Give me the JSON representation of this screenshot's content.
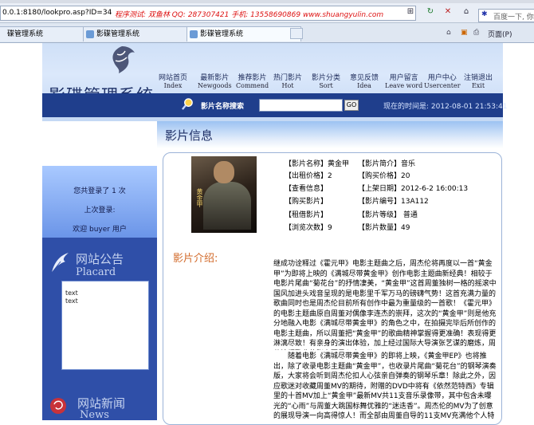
{
  "browser": {
    "url": "0.0.1:8180/lookpro.asp?ID=34",
    "ticker": "程序测试: 双鱼林  QQ: 287307421  手机: 13558690869  www.shuangyulin.com",
    "search_placeholder": "百度一下, 你",
    "tabs": [
      "碟管理系统",
      "影碟管理系统",
      "影碟管理系统"
    ],
    "page_menu": "页面(P)"
  },
  "header": {
    "site_title": "影碟管理系统",
    "nav": [
      {
        "cn": "网站首页",
        "en": "Index"
      },
      {
        "cn": "最新影片",
        "en": "Newgoods"
      },
      {
        "cn": "推荐影片",
        "en": "Commend"
      },
      {
        "cn": "热门影片",
        "en": "Hot"
      },
      {
        "cn": "影片分类",
        "en": "Sort"
      },
      {
        "cn": "意见反馈",
        "en": "Idea"
      },
      {
        "cn": "用户留言",
        "en": "Leave word"
      },
      {
        "cn": "用户中心",
        "en": "Usercenter"
      },
      {
        "cn": "注销退出",
        "en": "Exit"
      }
    ],
    "search_label": "影片名称搜索",
    "go_label": "GO",
    "time_label": "现在的时间是: 2012-08-01  21:53:41"
  },
  "left": {
    "user_lines": [
      "您共登录了 1 次",
      "上次登录:",
      "欢迎 buyer 用户"
    ],
    "placard_title": "网站公告",
    "placard_en": "Placard",
    "placard_text": [
      "text",
      "text"
    ],
    "news_title": "网站新闻",
    "news_en": "News"
  },
  "main": {
    "title": "影片信息",
    "poster_caption": "黄金甲",
    "info": [
      [
        "【影片名称】黄金甲",
        "【影片简介】音乐"
      ],
      [
        "【出租价格】2",
        "【购买价格】20"
      ],
      [
        "【查看信息】",
        "【上架日期】2012-6-2 16:00:13"
      ],
      [
        "【购买影片】",
        "【影片编号】13A112"
      ],
      [
        "【租借影片】",
        "【影片等级】 普通"
      ],
      [
        "【浏览次数】9",
        "【影片数量】49"
      ]
    ],
    "intro_title": "影片介绍:",
    "para1": "继成功诠释过《霍元甲》电影主题曲之后，周杰伦将再度以一首“黄金甲”为即将上映的《满城尽带黄金甲》创作电影主题曲新经典！相较于电影片尾曲“菊花台”的抒情凄美，“黄金甲”这首周董独树一格的摇滚中国风加进头戏音呈现的是电影里千军万马的磅礴气势！这首充满力量的歌曲同时也是周杰伦目前所有创作中最为重量级的一首歌！《霍元甲》的电影主题曲原自周董对偶像李连杰的崇拜，这次的“黄金甲”则是他充分地融入电影《满城尽带黄金甲》的角色之中，在拍摄完毕后所创作的电影主题曲，所以周董把“黄金甲”的歌曲精神掌握得更准确！表现得更淋漓尽致！有亲身的演出体验，加上经过国际大导演张艺谋的磨炼，周董诠释歌曲的张力更是入木三分！",
    "para2": "随着电影《满城尽带黄金甲》的即将上映，《黄金甲EP》也将推出，除了收录电影主题曲“黄金甲”，也收录片尾曲“菊花台”的钢琴演奏版，大家将会听到周杰伦扣人心弦亲自弹奏的钢琴乐章！除此之外，因应歌迷对收藏周董MV的期待，附赠的DVD中将有《依然范特西》专辑里的十首MV加上“黄金甲”最新MV共11支音乐录像带，其中包含未曝光的“心雨”与周董大跳国标舞优雅的“迷迭香”。周杰伦的MV为了创意的展现导演一向高得惊人！而全部由周董自导的11支MV充满他个人特色，是他对自我要求的一大突破，也刷新乐坛纪录，成为华语乐坛上第一位"
  },
  "colors": {
    "nav_dark": "#1f3e8c",
    "sidebar": "#2f4fa8",
    "intro_accent": "#d26a2a",
    "ticker_red": "#dd1111"
  }
}
